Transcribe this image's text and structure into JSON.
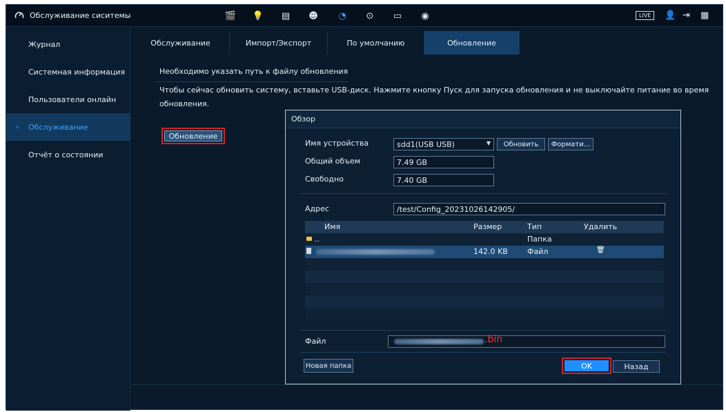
{
  "app": {
    "title": "Обслуживание сиситемы",
    "live_label": "LIVE"
  },
  "topbar_icons": [
    {
      "name": "video-clip-icon",
      "glyph": "🎬"
    },
    {
      "name": "alarm-light-icon",
      "glyph": "💡"
    },
    {
      "name": "storage-icon",
      "glyph": "▤"
    },
    {
      "name": "ai-head-icon",
      "glyph": "☻"
    },
    {
      "name": "maintenance-gauge-icon",
      "glyph": "◔"
    },
    {
      "name": "network-icon",
      "glyph": "⊙"
    },
    {
      "name": "display-icon",
      "glyph": "▭"
    },
    {
      "name": "audio-icon",
      "glyph": "◉"
    }
  ],
  "topbar_right": {
    "user_glyph": "👤",
    "logout_glyph": "⇥",
    "qr_glyph": "▦"
  },
  "colors": {
    "accent": "#3aa0ff",
    "highlight": "#d3212c",
    "ok": "#1f8fff"
  },
  "sidebar": {
    "items": [
      {
        "label": "Журнал"
      },
      {
        "label": "Системная информация"
      },
      {
        "label": "Пользователи онлайн"
      },
      {
        "label": "Обслуживание"
      },
      {
        "label": "Отчёт о состоянии"
      }
    ],
    "active_index": 3
  },
  "tabs": [
    {
      "label": "Обслуживание"
    },
    {
      "label": "Импорт/Экспорт"
    },
    {
      "label": "По умолчанию"
    },
    {
      "label": "Обновление"
    }
  ],
  "main": {
    "line1": "Необходимо указать путь к файлу обновления",
    "line2": "Чтобы сейчас обновить систему, вставьте USB-диск. Нажмите кнопку Пуск для запуска обновления и не выключайте питание во время",
    "line3": "обновления.",
    "update_button": "Обновление"
  },
  "dialog": {
    "title": "Обзор",
    "device_label": "Имя устройства",
    "device_value": "sdd1(USB USB)",
    "refresh_button": "Обновить",
    "format_button": "Формати...",
    "total_label": "Общий объем",
    "total_value": "7.49 GB",
    "free_label": "Свободно",
    "free_value": "7.40 GB",
    "address_label": "Адрес",
    "address_value": "/test/Config_20231026142905/",
    "table": {
      "headers": [
        "Имя",
        "Размер",
        "Тип",
        "Удалить"
      ],
      "rows": [
        {
          "name": "..",
          "size": "",
          "type": "Папка"
        },
        {
          "name": "",
          "size": "142.0 KB",
          "type": "Файл"
        }
      ]
    },
    "file_label": "Файл",
    "file_ext": ".bin",
    "new_folder_button": "Новая папка",
    "ok_button": "OK",
    "back_button": "Назад"
  }
}
